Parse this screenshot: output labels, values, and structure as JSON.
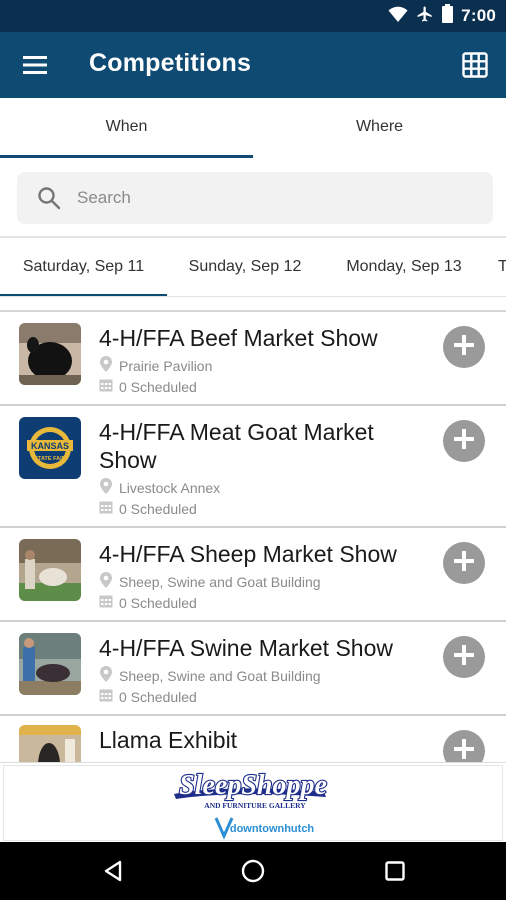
{
  "status_bar": {
    "time": "7:00",
    "icons": [
      "wifi-icon",
      "airplane-icon",
      "battery-icon"
    ]
  },
  "app_bar": {
    "title": "Competitions",
    "menu_icon": "hamburger-menu-icon",
    "action_icon": "grid-view-icon"
  },
  "colors": {
    "primary": "#0f4a72",
    "status_bar": "#0b2f4e",
    "add_button": "#9a9a9a"
  },
  "top_tabs": [
    {
      "label": "When",
      "active": true
    },
    {
      "label": "Where",
      "active": false
    }
  ],
  "search": {
    "placeholder": "Search",
    "value": ""
  },
  "date_tabs": [
    {
      "label": "Saturday, Sep 11",
      "active": true
    },
    {
      "label": "Sunday, Sep 12",
      "active": false
    },
    {
      "label": "Monday, Sep 13",
      "active": false
    }
  ],
  "competitions": [
    {
      "title": "4-H/FFA Beef Market Show",
      "location": "Prairie Pavilion",
      "scheduled": "0 Scheduled",
      "thumb": "beef-cattle-photo"
    },
    {
      "title": "4-H/FFA Meat Goat Market Show",
      "location": "Livestock Annex",
      "scheduled": "0 Scheduled",
      "thumb": "kansas-state-fair-logo"
    },
    {
      "title": "4-H/FFA Sheep Market Show",
      "location": "Sheep, Swine and Goat Building",
      "scheduled": "0 Scheduled",
      "thumb": "sheep-show-photo"
    },
    {
      "title": "4-H/FFA Swine Market Show",
      "location": "Sheep, Swine and Goat Building",
      "scheduled": "0 Scheduled",
      "thumb": "swine-show-photo"
    },
    {
      "title": "Llama Exhibit",
      "location": "",
      "scheduled": "",
      "thumb": "llama-photo"
    }
  ],
  "ad": {
    "brand": "SleepShoppe",
    "tagline": "AND FURNITURE GALLERY",
    "sub": "downtownhutch"
  },
  "kansas_logo": {
    "top": "KANSAS",
    "bottom": "STATE FAIR"
  },
  "nav_bar": {
    "buttons": [
      "back-icon",
      "home-icon",
      "recents-icon"
    ]
  }
}
